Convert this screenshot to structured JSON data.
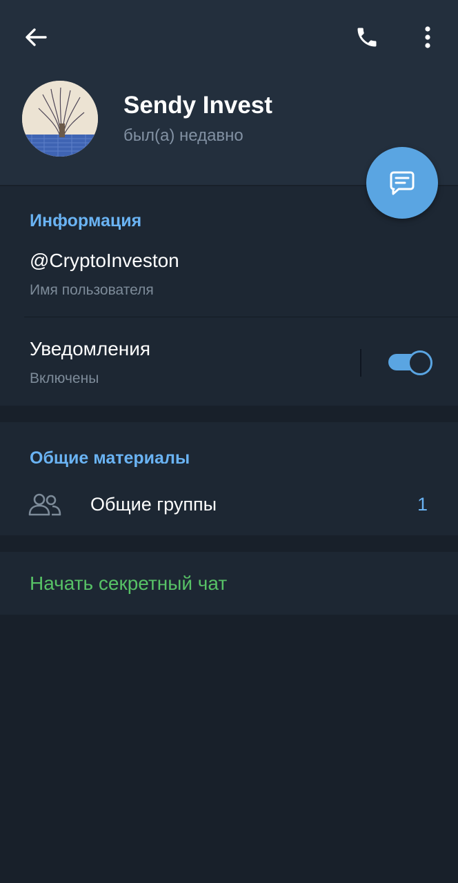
{
  "header": {
    "back_icon": "arrow-left-icon",
    "call_icon": "phone-icon",
    "more_icon": "more-vertical-icon",
    "background_color": "#232f3d"
  },
  "profile": {
    "name": "Sendy Invest",
    "status": "был(а) недавно",
    "avatar_icon": "avatar-photo",
    "message_icon": "message-icon",
    "fab_color": "#5aa5e2"
  },
  "info": {
    "title": "Информация",
    "username_value": "@CryptoInveston",
    "username_caption": "Имя пользователя",
    "notifications_label": "Уведомления",
    "notifications_status": "Включены",
    "notifications_enabled": true
  },
  "shared": {
    "title": "Общие материалы",
    "groups_icon": "group-icon",
    "groups_label": "Общие группы",
    "groups_count": "1"
  },
  "secret": {
    "label": "Начать секретный чат",
    "color": "#57c266"
  },
  "colors": {
    "accent": "#6ab3f3",
    "page_background": "#18202a",
    "section_background": "#1d2733"
  }
}
